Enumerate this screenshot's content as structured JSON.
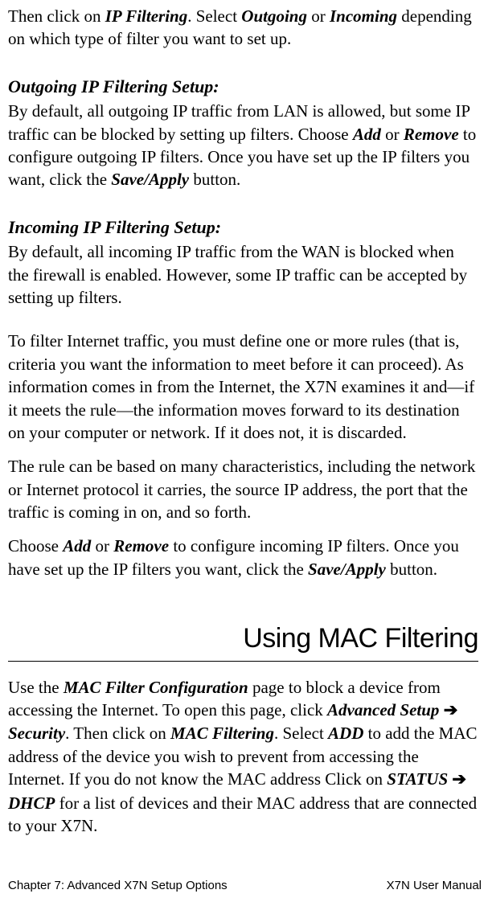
{
  "intro_pre": "Then click on ",
  "intro_ip": "IP Filtering",
  "intro_mid1": ".  Select ",
  "intro_out": "Outgoing",
  "intro_or": " or ",
  "intro_in": "Incoming",
  "intro_post": " depending on which type of filter you want to set up.",
  "out_heading": "Outgoing IP Filtering Setup:",
  "out_p1_a": "By default, all outgoing IP traffic from LAN is allowed, but some IP traffic can be blocked by setting up filters. Choose ",
  "out_add": "Add",
  "out_or": " or ",
  "out_remove": "Remove",
  "out_p1_b": " to configure outgoing IP filters. Once you have set up the IP filters you want, click the ",
  "out_save": "Save/Apply",
  "out_p1_c": " button.",
  "in_heading": "Incoming IP Filtering Setup:",
  "in_p1": "By default, all incoming IP traffic from the WAN is blocked when the firewall is enabled.  However, some IP traffic can be accepted by setting up filters.",
  "in_p2": "To filter Internet traffic, you must define one or more rules (that is, criteria you want the information to meet before it can proceed). As information comes in from the Internet, the X7N examines it and—if it meets the rule—the information moves forward to its destination on your computer or network. If it does not, it is discarded.",
  "in_p3": "The rule can be based on many characteristics, including the network or Internet protocol it carries, the source IP address, the port that the traffic is coming in on, and so forth.",
  "in_p4_a": "Choose ",
  "in_add": "Add",
  "in_or": " or ",
  "in_remove": "Remove",
  "in_p4_b": " to configure incoming IP filters. Once you have set up the IP filters you want, click the ",
  "in_save": "Save/Apply",
  "in_p4_c": " button.",
  "h1": "Using MAC Filtering",
  "mac_a": "Use the ",
  "mac_conf": "MAC Filter Configuration",
  "mac_b": " page to block a device from accessing the Internet. To open this page, click ",
  "mac_adv": "Advanced Setup ",
  "arrow": "➔",
  "mac_sec": " Security",
  "mac_c": ".  Then click on ",
  "mac_filt": "MAC Filtering",
  "mac_d": ".  Select ",
  "mac_add": "ADD",
  "mac_e": " to add the MAC address of the device you wish to prevent from accessing the Internet.  If you do not know the MAC address Click on ",
  "mac_status": "STATUS ",
  "mac_dhcp": " DHCP",
  "mac_f": " for a list of devices and their MAC address that are connected to your X7N.",
  "footer_left": "Chapter 7: Advanced X7N Setup Options",
  "footer_right": "X7N User Manual"
}
